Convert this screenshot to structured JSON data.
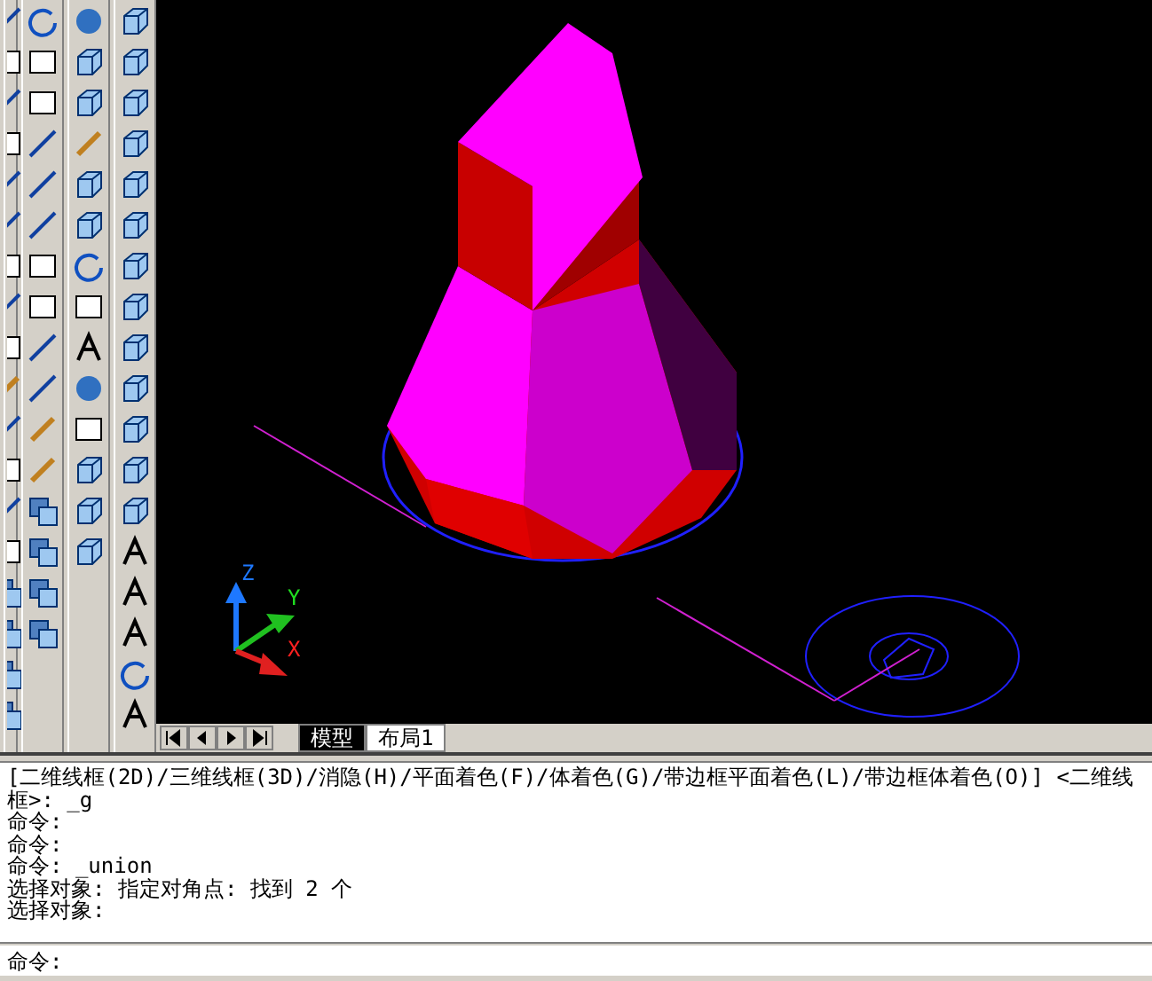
{
  "viewport": {
    "ucs_labels": [
      "Z",
      "Y",
      "X"
    ]
  },
  "layout_tabs": [
    {
      "label": "模型",
      "selected": true
    },
    {
      "label": "布局1",
      "selected": false
    }
  ],
  "command_history": [
    "[二维线框(2D)/三维线框(3D)/消隐(H)/平面着色(F)/体着色(G)/带边框平面着色(L)/带边框体着色(O)] <二维线框>: _g",
    "命令:",
    "命令:",
    "命令: _union",
    "选择对象: 指定对角点: 找到 2 个",
    "选择对象:"
  ],
  "command_line": {
    "value": "命令:"
  }
}
